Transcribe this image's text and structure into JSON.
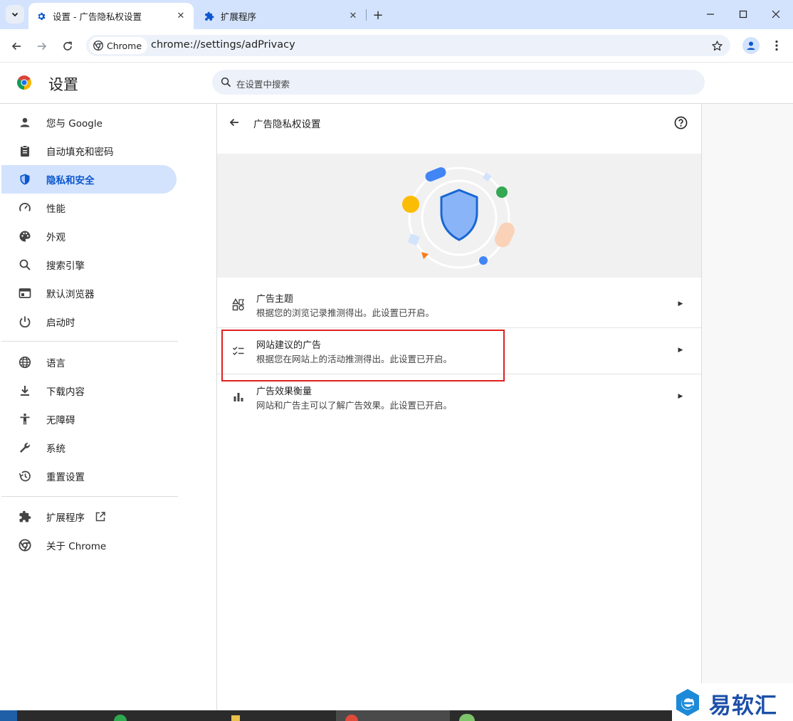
{
  "tabs": [
    {
      "title": "设置 - 广告隐私权设置",
      "icon": "gear-icon",
      "active": true
    },
    {
      "title": "扩展程序",
      "icon": "puzzle-icon",
      "active": false
    }
  ],
  "toolbar": {
    "chip_label": "Chrome",
    "url": "chrome://settings/adPrivacy"
  },
  "header": {
    "title": "设置",
    "search_placeholder": "在设置中搜索"
  },
  "sidebar": {
    "items": [
      {
        "label": "您与 Google",
        "icon": "person-icon"
      },
      {
        "label": "自动填充和密码",
        "icon": "clipboard-icon"
      },
      {
        "label": "隐私和安全",
        "icon": "shield-icon",
        "active": true
      },
      {
        "label": "性能",
        "icon": "speedometer-icon"
      },
      {
        "label": "外观",
        "icon": "palette-icon"
      },
      {
        "label": "搜索引擎",
        "icon": "search-icon"
      },
      {
        "label": "默认浏览器",
        "icon": "browser-window-icon"
      },
      {
        "label": "启动时",
        "icon": "power-icon"
      },
      {
        "label": "语言",
        "icon": "globe-icon"
      },
      {
        "label": "下载内容",
        "icon": "download-icon"
      },
      {
        "label": "无障碍",
        "icon": "accessibility-icon"
      },
      {
        "label": "系统",
        "icon": "wrench-icon"
      },
      {
        "label": "重置设置",
        "icon": "history-icon"
      },
      {
        "label": "扩展程序",
        "icon": "puzzle-icon"
      },
      {
        "label": "关于 Chrome",
        "icon": "chrome-logo-icon"
      }
    ]
  },
  "main": {
    "page_title": "广告隐私权设置",
    "rows": [
      {
        "title": "广告主题",
        "subtitle": "根据您的浏览记录推测得出。此设置已开启。",
        "icon": "topics-icon"
      },
      {
        "title": "网站建议的广告",
        "subtitle": "根据您在网站上的活动推测得出。此设置已开启。",
        "icon": "checklist-icon"
      },
      {
        "title": "广告效果衡量",
        "subtitle": "网站和广告主可以了解广告效果。此设置已开启。",
        "icon": "bar-chart-icon"
      }
    ]
  },
  "watermark": {
    "text": "易软汇"
  },
  "colors": {
    "accent": "#0b57d0",
    "tab_strip": "#d3e3fd",
    "highlight_box": "#e02020",
    "active_nav_bg": "#d3e3fd"
  }
}
